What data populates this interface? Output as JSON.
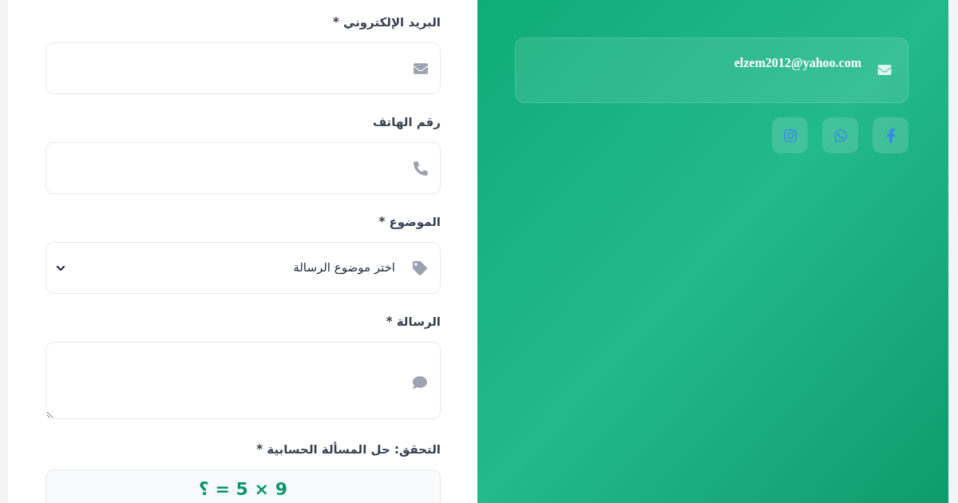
{
  "contact": {
    "email": "elzem2012@yahoo.com",
    "social": [
      {
        "kind": "facebook"
      },
      {
        "kind": "whatsapp"
      },
      {
        "kind": "instagram"
      }
    ]
  },
  "form": {
    "fields": [
      {
        "kind": "email",
        "label": "البريد الإلكتروني *"
      },
      {
        "kind": "phone",
        "label": "رقم الهاتف"
      },
      {
        "kind": "select",
        "label": "الموضوع *",
        "placeholder": "اختر موضوع الرسالة"
      },
      {
        "kind": "textarea",
        "label": "الرسالة *"
      }
    ],
    "captcha": {
      "label": "التحقق: حل المسألة الحسابية *",
      "question": "9 × 5 = ؟"
    }
  }
}
